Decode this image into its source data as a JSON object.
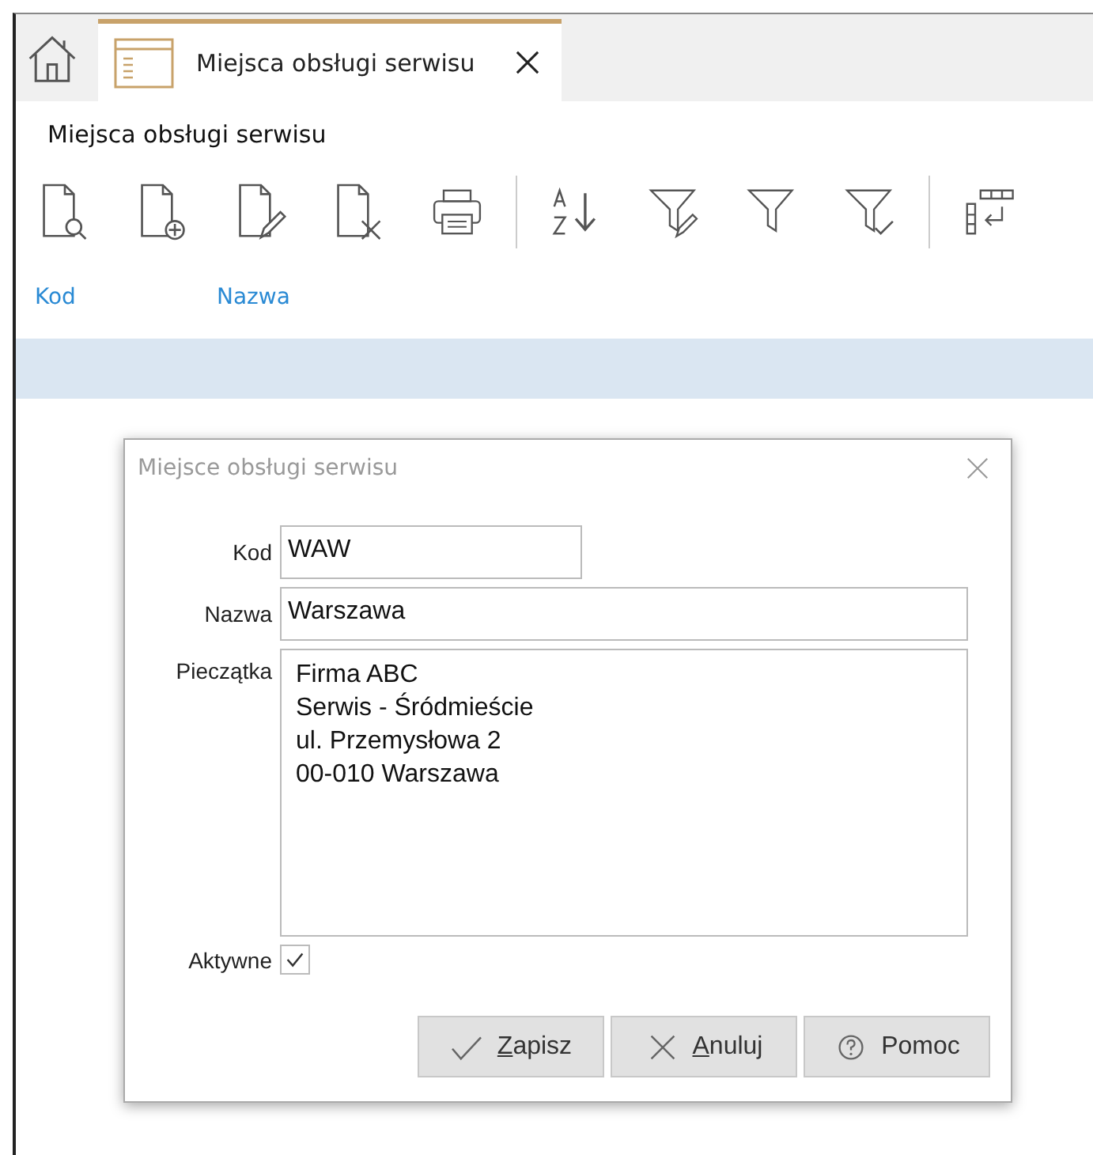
{
  "tabs": [
    {
      "label": "Miejsca obsługi serwisu",
      "selected": true
    }
  ],
  "page_title": "Miejsca obsługi serwisu",
  "toolbar": [
    {
      "kind": "view"
    },
    {
      "kind": "add"
    },
    {
      "kind": "edit"
    },
    {
      "kind": "delete"
    },
    {
      "kind": "print"
    },
    {
      "kind": "separator"
    },
    {
      "kind": "sort"
    },
    {
      "kind": "filter-edit"
    },
    {
      "kind": "filter"
    },
    {
      "kind": "filter-check"
    },
    {
      "kind": "separator"
    },
    {
      "kind": "columns"
    }
  ],
  "table": {
    "columns": [
      "Kod",
      "Nazwa"
    ],
    "rows": [
      {
        "selected": true
      }
    ]
  },
  "dialog": {
    "title": "Miejsce obsługi serwisu",
    "fields": [
      {
        "label": "Kod",
        "value": "WAW",
        "kind": "short"
      },
      {
        "label": "Nazwa",
        "value": "Warszawa",
        "kind": "long"
      }
    ],
    "stamp": {
      "label": "Pieczątka",
      "lines": [
        "Firma ABC",
        "Serwis - Śródmieście",
        "ul. Przemysłowa 2",
        "00-010 Warszawa"
      ]
    },
    "active": {
      "label": "Aktywne",
      "checked": true
    },
    "buttons": [
      {
        "label": "Zapisz",
        "kind": "save",
        "mnemonic": true
      },
      {
        "label": "Anuluj",
        "kind": "cancel",
        "mnemonic": true
      },
      {
        "label": "Pomoc",
        "kind": "help",
        "mnemonic": false
      }
    ]
  }
}
